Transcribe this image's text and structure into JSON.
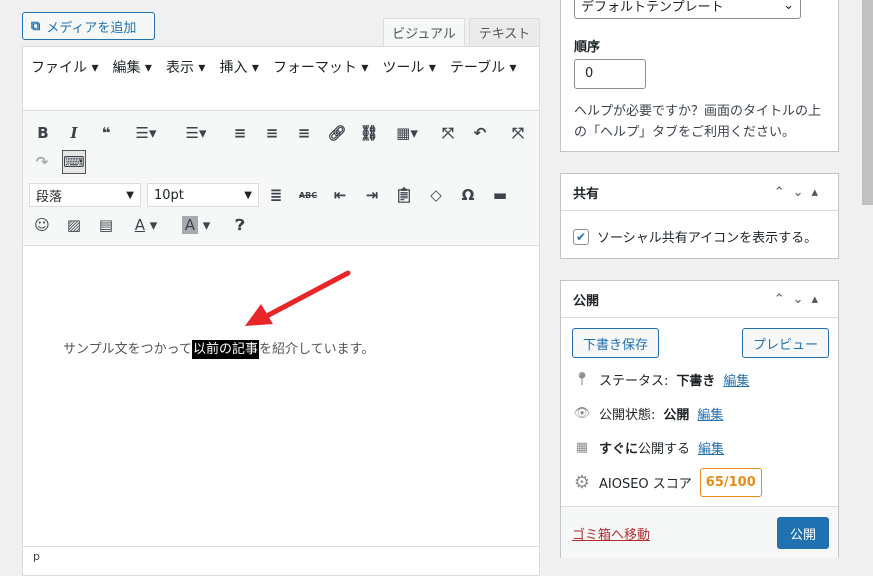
{
  "media_button": "メディアを追加",
  "tabs": {
    "visual": "ビジュアル",
    "text": "テキスト"
  },
  "menu": [
    "ファイル ▾",
    "編集 ▾",
    "表示 ▾",
    "挿入 ▾",
    "フォーマット ▾",
    "ツール ▾",
    "テーブル ▾"
  ],
  "toolbar": {
    "format_select": "段落",
    "size_select": "10pt"
  },
  "content": {
    "before": "サンプル文をつかって",
    "highlight": "以前の記事",
    "after": "を紹介しています。"
  },
  "statusbar": "p",
  "attributes": {
    "template": "デフォルトテンプレート",
    "order_label": "順序",
    "order_value": "0",
    "help": "ヘルプが必要ですか？画面のタイトルの上の「ヘルプ」タブをご利用ください。"
  },
  "share": {
    "title": "共有",
    "checkbox_label": "ソーシャル共有アイコンを表示する。",
    "checked": true
  },
  "publish": {
    "title": "公開",
    "save_draft": "下書き保存",
    "preview": "プレビュー",
    "status_label": "ステータス:",
    "status_value": "下書き",
    "visibility_label": "公開状態:",
    "visibility_value": "公開",
    "schedule_bold": "すぐに",
    "schedule_rest": "公開する",
    "edit": "編集",
    "aioseo_label": "AIOSEO スコア",
    "aioseo_score": "65/100",
    "trash": "ゴミ箱へ移動",
    "publish_button": "公開"
  },
  "colors": {
    "accent": "#2271b1",
    "score": "#e88a1a",
    "trash": "#b32d2e",
    "arrow": "#e8262a"
  }
}
